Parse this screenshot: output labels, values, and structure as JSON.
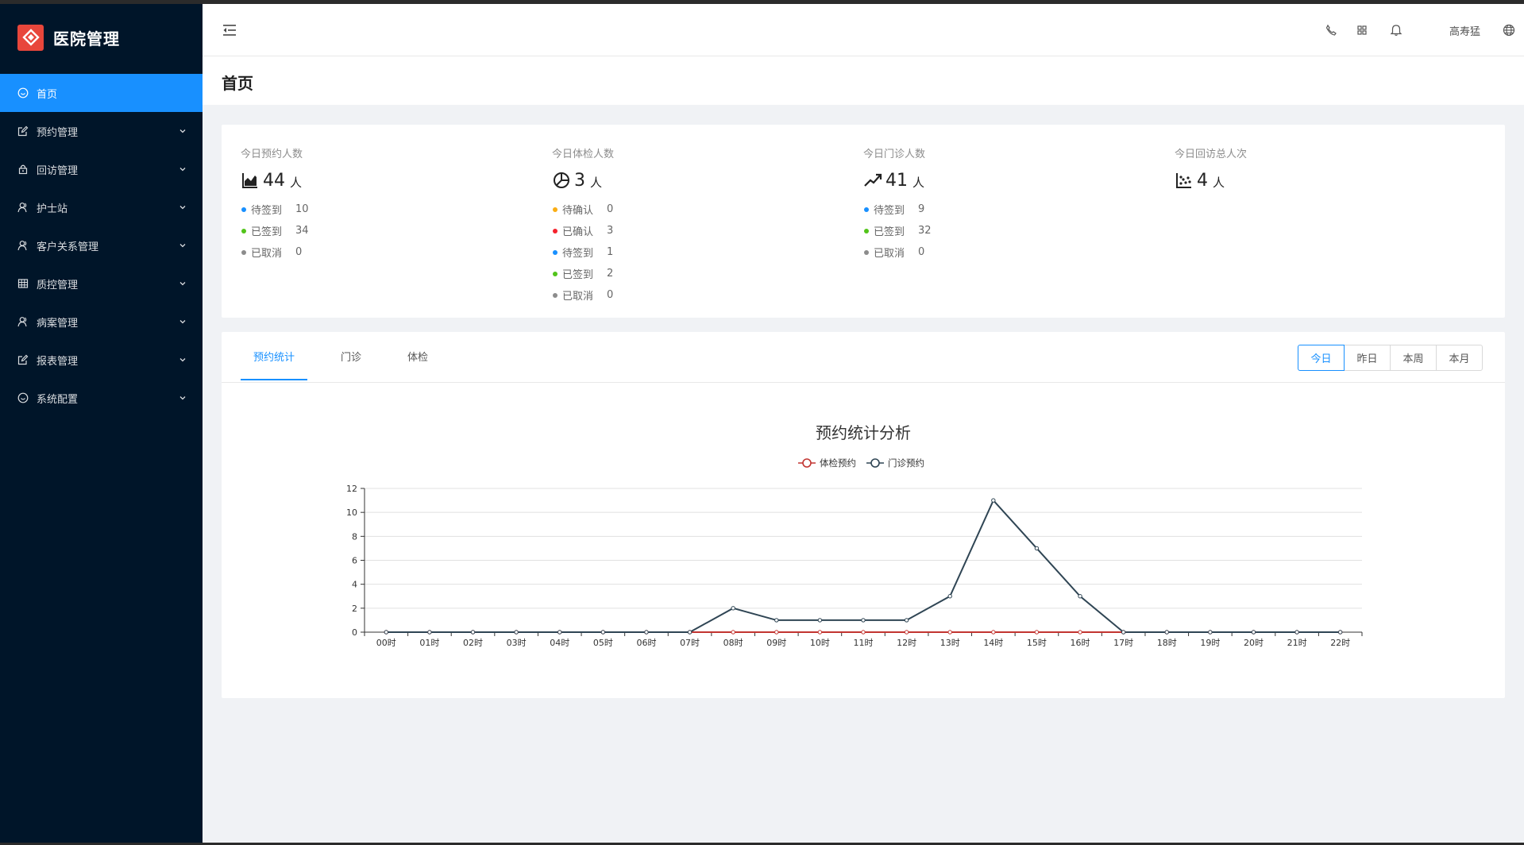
{
  "app": {
    "title": "医院管理",
    "brand_color": "#e8463b"
  },
  "sidebar": {
    "items": [
      {
        "label": "首页",
        "icon": "dashboard-icon",
        "active": true,
        "has_children": false
      },
      {
        "label": "预约管理",
        "icon": "edit-icon",
        "active": false,
        "has_children": true
      },
      {
        "label": "回访管理",
        "icon": "lock-icon",
        "active": false,
        "has_children": true
      },
      {
        "label": "护士站",
        "icon": "user-icon",
        "active": false,
        "has_children": true
      },
      {
        "label": "客户关系管理",
        "icon": "user-icon",
        "active": false,
        "has_children": true
      },
      {
        "label": "质控管理",
        "icon": "table-icon",
        "active": false,
        "has_children": true
      },
      {
        "label": "病案管理",
        "icon": "user-icon",
        "active": false,
        "has_children": true
      },
      {
        "label": "报表管理",
        "icon": "edit-icon",
        "active": false,
        "has_children": true
      },
      {
        "label": "系统配置",
        "icon": "dashboard-icon",
        "active": false,
        "has_children": true
      }
    ]
  },
  "header": {
    "user_name": "高寿猛",
    "icons": [
      "phone-icon",
      "apps-icon",
      "bell-icon",
      "globe-icon"
    ]
  },
  "page": {
    "title": "首页"
  },
  "stats": [
    {
      "label": "今日预约人数",
      "value": "44",
      "unit": "人",
      "icon": "area-chart-icon",
      "items": [
        {
          "label": "待签到",
          "value": "10",
          "color": "#1890ff"
        },
        {
          "label": "已签到",
          "value": "34",
          "color": "#52c41a"
        },
        {
          "label": "已取消",
          "value": "0",
          "color": "#8c8c8c"
        }
      ]
    },
    {
      "label": "今日体检人数",
      "value": "3",
      "unit": "人",
      "icon": "pie-chart-icon",
      "items": [
        {
          "label": "待确认",
          "value": "0",
          "color": "#faad14"
        },
        {
          "label": "已确认",
          "value": "3",
          "color": "#f5222d"
        },
        {
          "label": "待签到",
          "value": "1",
          "color": "#1890ff"
        },
        {
          "label": "已签到",
          "value": "2",
          "color": "#52c41a"
        },
        {
          "label": "已取消",
          "value": "0",
          "color": "#8c8c8c"
        }
      ]
    },
    {
      "label": "今日门诊人数",
      "value": "41",
      "unit": "人",
      "icon": "line-chart-icon",
      "items": [
        {
          "label": "待签到",
          "value": "9",
          "color": "#1890ff"
        },
        {
          "label": "已签到",
          "value": "32",
          "color": "#52c41a"
        },
        {
          "label": "已取消",
          "value": "0",
          "color": "#8c8c8c"
        }
      ]
    },
    {
      "label": "今日回访总人次",
      "value": "4",
      "unit": "人",
      "icon": "dot-chart-icon",
      "items": []
    }
  ],
  "tabs": [
    {
      "label": "预约统计",
      "active": true
    },
    {
      "label": "门诊",
      "active": false
    },
    {
      "label": "体检",
      "active": false
    }
  ],
  "range": [
    {
      "label": "今日",
      "active": true
    },
    {
      "label": "昨日",
      "active": false
    },
    {
      "label": "本周",
      "active": false
    },
    {
      "label": "本月",
      "active": false
    }
  ],
  "chart_data": {
    "type": "line",
    "title": "预约统计分析",
    "categories": [
      "00时",
      "01时",
      "02时",
      "03时",
      "04时",
      "05时",
      "06时",
      "07时",
      "08时",
      "09时",
      "10时",
      "11时",
      "12时",
      "13时",
      "14时",
      "15时",
      "16时",
      "17时",
      "18时",
      "19时",
      "20时",
      "21时",
      "22时"
    ],
    "series": [
      {
        "name": "体检预约",
        "color": "#c23531",
        "values": [
          0,
          0,
          0,
          0,
          0,
          0,
          0,
          0,
          0,
          0,
          0,
          0,
          0,
          0,
          0,
          0,
          0,
          0,
          0,
          0,
          0,
          0,
          0
        ]
      },
      {
        "name": "门诊预约",
        "color": "#2f4554",
        "values": [
          0,
          0,
          0,
          0,
          0,
          0,
          0,
          0,
          2,
          1,
          1,
          1,
          1,
          3,
          11,
          7,
          3,
          0,
          0,
          0,
          0,
          0,
          0
        ]
      }
    ],
    "ylim": [
      0,
      12
    ],
    "yticks": [
      0,
      2,
      4,
      6,
      8,
      10,
      12
    ],
    "grid": true,
    "legend": "top-center"
  }
}
